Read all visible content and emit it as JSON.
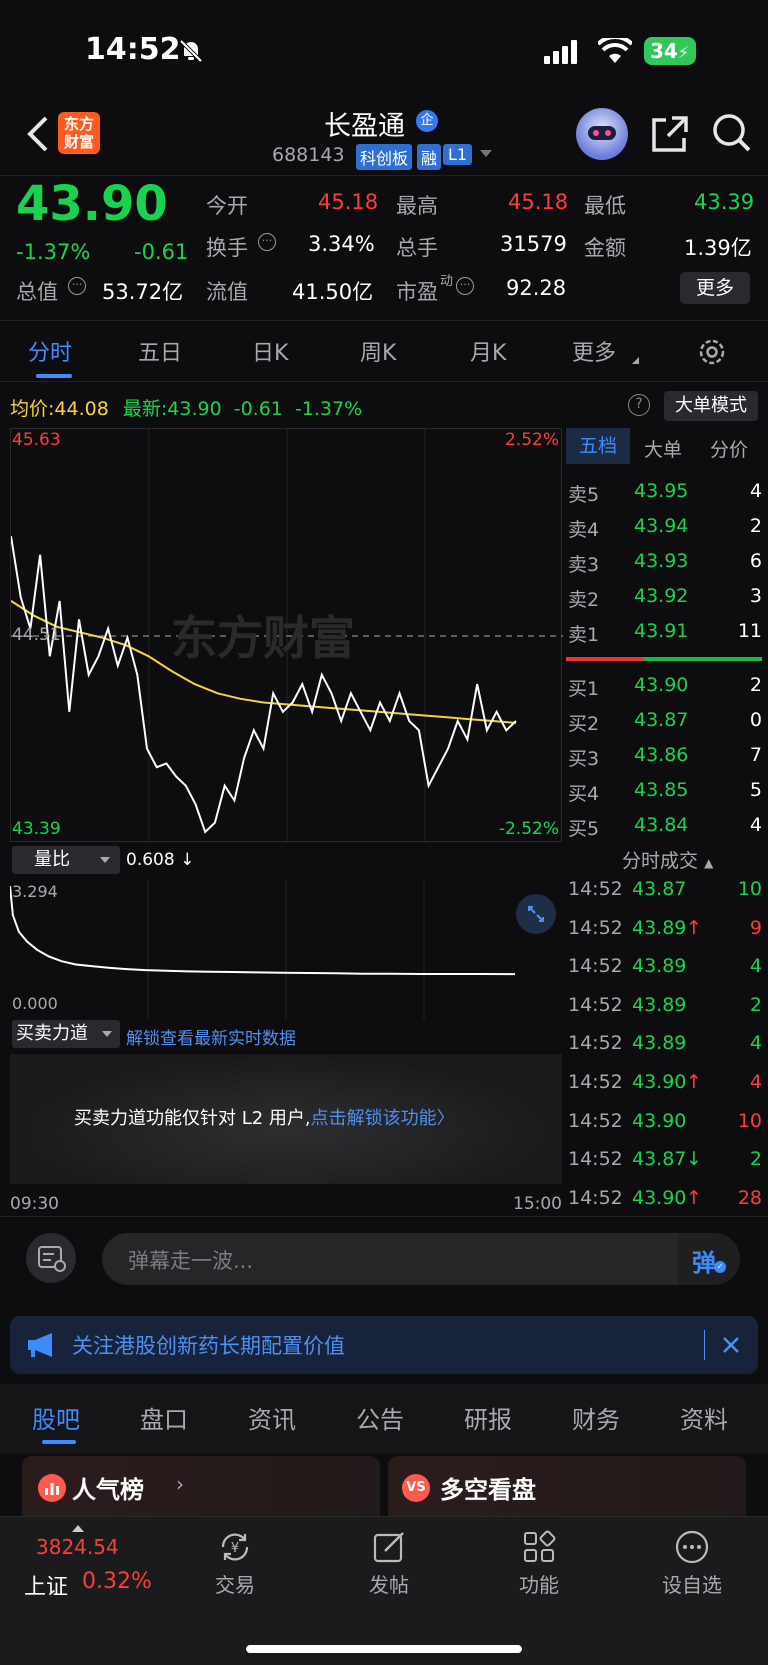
{
  "status_bar": {
    "time": "14:52",
    "battery": "34"
  },
  "header": {
    "back_icon": "chevron-left-icon",
    "logo_text": "东方\n财富",
    "stock_name": "长盈通",
    "enterprise_badge": "企",
    "code": "688143",
    "tags": [
      "科创板",
      "融",
      "L1"
    ]
  },
  "quote": {
    "price": "43.90",
    "change_pct": "-1.37%",
    "change": "-0.61",
    "metrics": [
      {
        "label": "今开",
        "value": "45.18",
        "color": "red"
      },
      {
        "label": "最高",
        "value": "45.18",
        "color": "red"
      },
      {
        "label": "最低",
        "value": "43.39",
        "color": "green"
      },
      {
        "label": "换手",
        "value": "3.34%",
        "color": "white"
      },
      {
        "label": "总手",
        "value": "31579",
        "color": "white"
      },
      {
        "label": "金额",
        "value": "1.39亿",
        "color": "white"
      },
      {
        "label": "总值",
        "value": "53.72亿",
        "color": "white"
      },
      {
        "label": "流值",
        "value": "41.50亿",
        "color": "white"
      },
      {
        "label": "市盈",
        "value": "92.28",
        "color": "white"
      }
    ],
    "pe_super": "动",
    "more_button": "更多"
  },
  "period_tabs": [
    "分时",
    "五日",
    "日K",
    "周K",
    "月K",
    "更多"
  ],
  "chart_info": {
    "avg_label": "均价:",
    "avg_value": "44.08",
    "last_label": "最新:",
    "last_value": "43.90",
    "last_change": "-0.61",
    "last_pct": "-1.37%",
    "big_order_mode": "大单模式"
  },
  "chart_data": {
    "type": "line",
    "title": "",
    "price_max": "45.63",
    "price_min": "43.39",
    "pct_max": "2.52%",
    "pct_min": "-2.52%",
    "ref_price": "44.51",
    "ylim": [
      43.39,
      45.63
    ],
    "x_start": "09:30",
    "x_end": "15:00",
    "series": [
      {
        "name": "最新",
        "values": [
          45.05,
          44.72,
          44.55,
          44.95,
          44.4,
          44.7,
          44.1,
          44.6,
          44.3,
          44.4,
          44.55,
          44.35,
          44.5,
          44.3,
          43.9,
          43.8,
          43.82,
          43.75,
          43.7,
          43.6,
          43.45,
          43.5,
          43.7,
          43.62,
          43.85,
          44.0,
          43.9,
          44.2,
          44.1,
          44.15,
          44.25,
          44.1,
          44.3,
          44.2,
          44.05,
          44.2,
          44.1,
          44.0,
          44.15,
          44.05,
          44.2,
          44.05,
          44.0,
          43.7,
          43.8,
          43.9,
          44.05,
          43.95,
          44.25,
          44.0,
          44.1,
          44.0,
          44.05
        ]
      },
      {
        "name": "均价",
        "values": [
          44.7,
          44.62,
          44.56,
          44.53,
          44.5,
          44.46,
          44.4,
          44.32,
          44.25,
          44.2,
          44.17,
          44.15,
          44.14,
          44.13,
          44.12,
          44.11,
          44.1,
          44.09,
          44.08,
          44.07,
          44.06,
          44.05,
          44.04
        ]
      }
    ],
    "volume_ratio": {
      "label": "量比",
      "value": "0.608 ↓",
      "max": "3.294",
      "min": "0.000",
      "values": [
        3.29,
        2.4,
        1.9,
        1.6,
        1.35,
        1.15,
        1.0,
        0.9,
        0.85,
        0.8,
        0.76,
        0.73,
        0.71,
        0.69,
        0.68,
        0.67,
        0.66,
        0.65,
        0.64,
        0.63,
        0.62,
        0.62,
        0.61,
        0.61,
        0.61,
        0.608
      ]
    }
  },
  "order_book": {
    "tabs": [
      "五档",
      "大单",
      "分价"
    ],
    "sell": [
      {
        "label": "卖5",
        "price": "43.95",
        "vol": "4"
      },
      {
        "label": "卖4",
        "price": "43.94",
        "vol": "2"
      },
      {
        "label": "卖3",
        "price": "43.93",
        "vol": "6"
      },
      {
        "label": "卖2",
        "price": "43.92",
        "vol": "3"
      },
      {
        "label": "卖1",
        "price": "43.91",
        "vol": "11"
      }
    ],
    "buy": [
      {
        "label": "买1",
        "price": "43.90",
        "vol": "2"
      },
      {
        "label": "买2",
        "price": "43.87",
        "vol": "0"
      },
      {
        "label": "买3",
        "price": "43.86",
        "vol": "7"
      },
      {
        "label": "买4",
        "price": "43.85",
        "vol": "5"
      },
      {
        "label": "买5",
        "price": "43.84",
        "vol": "4"
      }
    ],
    "trades_title": "分时成交",
    "trades": [
      {
        "time": "14:52",
        "price": "43.87",
        "arrow": "",
        "vol": "10",
        "vol_color": "green"
      },
      {
        "time": "14:52",
        "price": "43.89",
        "arrow": "↑",
        "vol": "9",
        "vol_color": "red"
      },
      {
        "time": "14:52",
        "price": "43.89",
        "arrow": "",
        "vol": "4",
        "vol_color": "green"
      },
      {
        "time": "14:52",
        "price": "43.89",
        "arrow": "",
        "vol": "2",
        "vol_color": "green"
      },
      {
        "time": "14:52",
        "price": "43.89",
        "arrow": "",
        "vol": "4",
        "vol_color": "green"
      },
      {
        "time": "14:52",
        "price": "43.90",
        "arrow": "↑",
        "vol": "4",
        "vol_color": "red"
      },
      {
        "time": "14:52",
        "price": "43.90",
        "arrow": "",
        "vol": "10",
        "vol_color": "red"
      },
      {
        "time": "14:52",
        "price": "43.87",
        "arrow": "↓",
        "vol": "2",
        "vol_color": "green"
      },
      {
        "time": "14:52",
        "price": "43.90",
        "arrow": "↑",
        "vol": "28",
        "vol_color": "red"
      }
    ]
  },
  "buy_sell_power": {
    "label": "买卖力道",
    "unlock_link": "解锁查看最新实时数据",
    "notice": "买卖力道功能仅针对 L2 用户,",
    "notice_link": "点击解锁该功能"
  },
  "danmaku": {
    "placeholder": "弹幕走一波...",
    "send_label": "弹"
  },
  "banner": {
    "text": "关注港股创新药长期配置价值"
  },
  "bottom_tabs": [
    "股吧",
    "盘口",
    "资讯",
    "公告",
    "研报",
    "财务",
    "资料"
  ],
  "cards": [
    {
      "label": "人气榜"
    },
    {
      "label": "多空看盘"
    }
  ],
  "nav": {
    "index_value": "3824.54",
    "index_name": "上证",
    "index_pct": "0.32%",
    "items": [
      "交易",
      "发帖",
      "功能",
      "设自选"
    ]
  }
}
